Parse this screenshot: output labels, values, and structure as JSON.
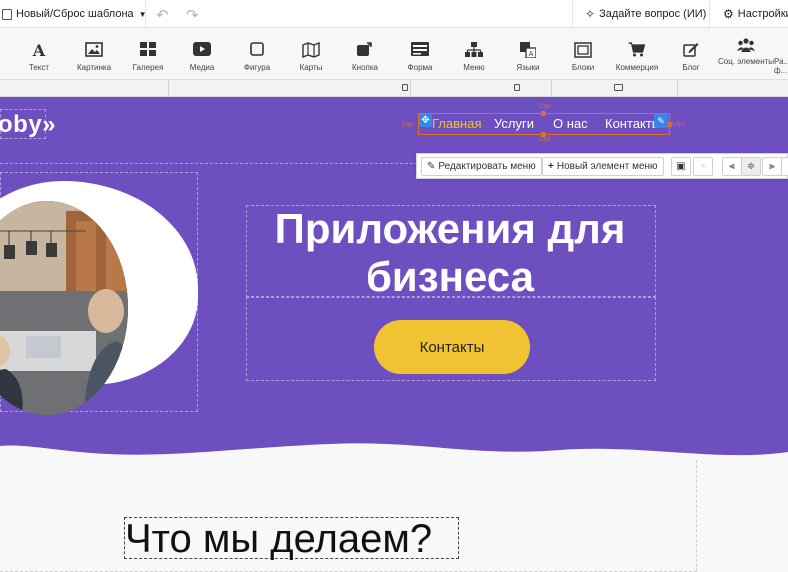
{
  "topbar": {
    "template_label": "Новый/Сброс шаблона",
    "ai_label": "Задайте вопрос (ИИ)",
    "settings_label": "Настройки"
  },
  "toolbar": {
    "tools": [
      {
        "label": "Текст",
        "icon": "text-icon"
      },
      {
        "label": "Картинка",
        "icon": "image-icon"
      },
      {
        "label": "Галерея",
        "icon": "gallery-icon"
      },
      {
        "label": "Медиа",
        "icon": "media-icon"
      },
      {
        "label": "Фигура",
        "icon": "shape-icon"
      },
      {
        "label": "Карты",
        "icon": "map-icon"
      },
      {
        "label": "Кнопка",
        "icon": "button-icon"
      },
      {
        "label": "Форма",
        "icon": "form-icon"
      },
      {
        "label": "Меню",
        "icon": "menu-icon"
      },
      {
        "label": "Языки",
        "icon": "languages-icon"
      },
      {
        "label": "Блоки",
        "icon": "blocks-icon"
      },
      {
        "label": "Коммерция",
        "icon": "cart-icon"
      },
      {
        "label": "Блог",
        "icon": "blog-icon"
      },
      {
        "label": "Соц. элементы",
        "icon": "social-icon"
      },
      {
        "label": "Ра... ф...",
        "icon": "more-icon"
      }
    ]
  },
  "hero": {
    "logo": "oby»",
    "menu": [
      "Главная",
      "Услуги",
      "О нас",
      "Контакты"
    ],
    "padding_label": "10px",
    "menu_toolbar": {
      "edit_menu": "Редактировать меню",
      "new_item": "Новый элемент меню"
    },
    "title_line1": "Приложения для",
    "title_line2": "бизнеса",
    "cta": "Контакты"
  },
  "section2": {
    "title": "Что мы делаем?"
  },
  "colors": {
    "hero_bg": "#6d4fc0",
    "accent": "#f1c232",
    "selection": "#e06b2b",
    "handle": "#3a86e8"
  }
}
